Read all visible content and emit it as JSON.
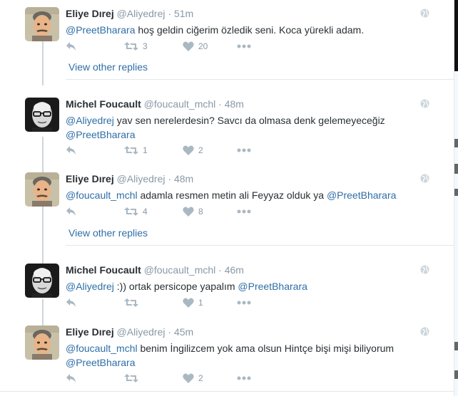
{
  "tweets": [
    {
      "name": "Eliye Dırej",
      "handle": "@Aliyedrej",
      "time": "51m",
      "text": [
        {
          "t": "@PreetBharara",
          "m": true
        },
        {
          "t": " hoş geldin ciğerim özledik seni. Koca yürekli adam.",
          "m": false
        }
      ],
      "retweets": "3",
      "likes": "20",
      "avatar": "eliye"
    },
    {
      "name": "Michel Foucault",
      "handle": "@foucault_mchl",
      "time": "48m",
      "text": [
        {
          "t": "@Aliyedrej",
          "m": true
        },
        {
          "t": " yav sen nerelerdesin? Savcı da olmasa denk gelemeyeceğiz ",
          "m": false
        },
        {
          "t": "@PreetBharara",
          "m": true
        }
      ],
      "retweets": "1",
      "likes": "2",
      "avatar": "michel"
    },
    {
      "name": "Eliye Dırej",
      "handle": "@Aliyedrej",
      "time": "48m",
      "text": [
        {
          "t": "@foucault_mchl",
          "m": true
        },
        {
          "t": "  adamla resmen metin ali Feyyaz olduk ya ",
          "m": false
        },
        {
          "t": "@PreetBharara",
          "m": true
        }
      ],
      "retweets": "4",
      "likes": "8",
      "avatar": "eliye"
    },
    {
      "name": "Michel Foucault",
      "handle": "@foucault_mchl",
      "time": "46m",
      "text": [
        {
          "t": "@Aliyedrej",
          "m": true
        },
        {
          "t": " :)) ortak persicope yapalım  ",
          "m": false
        },
        {
          "t": "@PreetBharara",
          "m": true
        }
      ],
      "retweets": "",
      "likes": "1",
      "avatar": "michel"
    },
    {
      "name": "Eliye Dırej",
      "handle": "@Aliyedrej",
      "time": "45m",
      "text": [
        {
          "t": "@foucault_mchl",
          "m": true
        },
        {
          "t": " benim İngilizcem yok ama olsun Hintçe bişi mişi biliyorum ",
          "m": false
        },
        {
          "t": "@PreetBharara",
          "m": true
        }
      ],
      "retweets": "",
      "likes": "2",
      "avatar": "eliye"
    }
  ],
  "view_other_replies": "View other replies",
  "separator": "·",
  "icons": {
    "reply": "reply-icon",
    "retweet": "retweet-icon",
    "like": "heart-icon",
    "more": "more-icon",
    "globe": "globe-icon"
  },
  "colors": {
    "link": "#2f6ea7",
    "muted": "#8899a6",
    "icon": "#aab8c2",
    "thread_line": "#ccd6dd"
  }
}
